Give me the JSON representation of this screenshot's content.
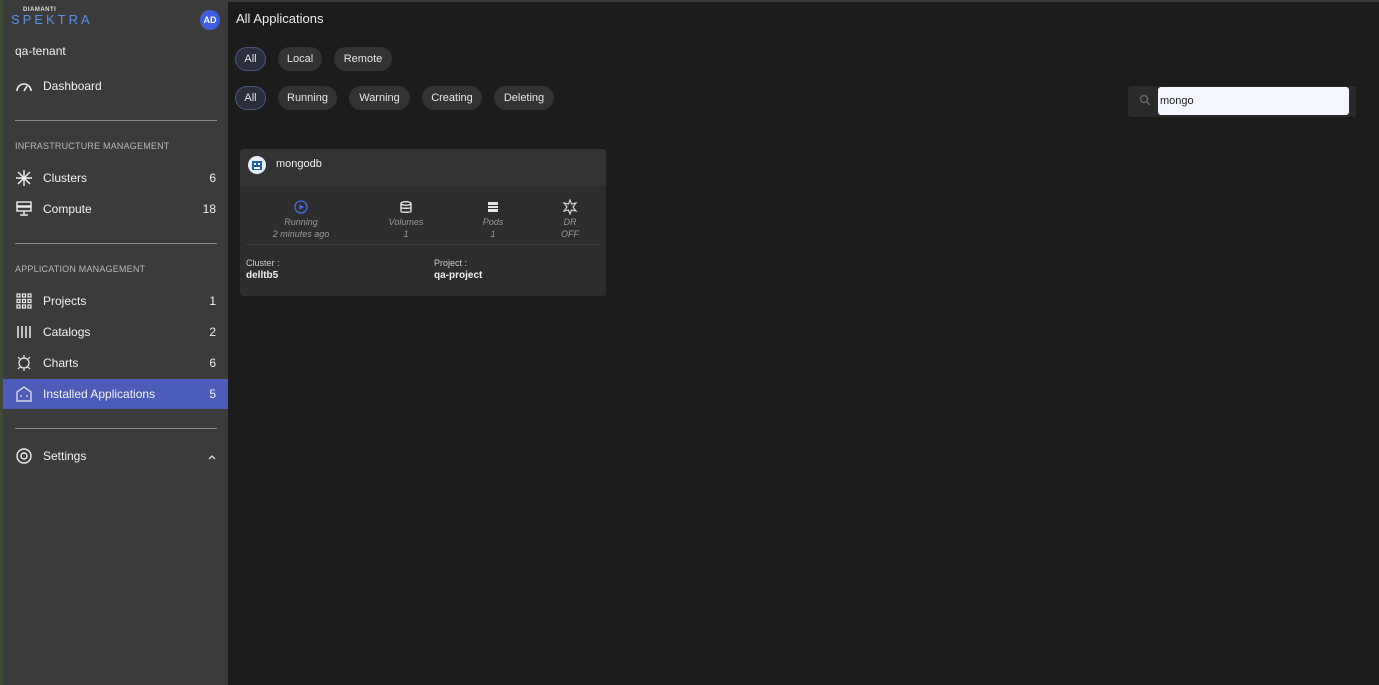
{
  "sidebar": {
    "logo_small": "DIAMANTI",
    "logo_big": "SPEKTRA",
    "avatar_initials": "AD",
    "tenant": "qa-tenant",
    "dashboard_label": "Dashboard",
    "infra_section": "INFRASTRUCTURE MANAGEMENT",
    "infra_items": [
      {
        "label": "Clusters",
        "count": "6",
        "icon": "clusters-icon"
      },
      {
        "label": "Compute",
        "count": "18",
        "icon": "compute-icon"
      }
    ],
    "app_section": "APPLICATION MANAGEMENT",
    "app_items": [
      {
        "label": "Projects",
        "count": "1",
        "icon": "projects-icon"
      },
      {
        "label": "Catalogs",
        "count": "2",
        "icon": "catalogs-icon"
      },
      {
        "label": "Charts",
        "count": "6",
        "icon": "helm-charts-icon"
      },
      {
        "label": "Installed Applications",
        "count": "5",
        "icon": "installed-apps-icon",
        "active": true
      }
    ],
    "settings_label": "Settings"
  },
  "main": {
    "title": "All Applications",
    "location_filters": [
      "All",
      "Local",
      "Remote"
    ],
    "status_filters": [
      "All",
      "Running",
      "Warning",
      "Creating",
      "Deleting"
    ],
    "search": {
      "value": "mongo"
    },
    "app_card": {
      "name": "mongodb",
      "status": "Running",
      "status_time": "2 minutes ago",
      "volumes_label": "Volumes",
      "volumes_value": "1",
      "pods_label": "Pods",
      "pods_value": "1",
      "dr_label": "DR",
      "dr_value": "OFF",
      "cluster_label": "Cluster :",
      "cluster_value": "delltb5",
      "project_label": "Project :",
      "project_value": "qa-project"
    }
  },
  "colors": {
    "sidebar_bg": "#3b3b3b",
    "main_bg": "#1c1c1c",
    "active_nav": "#4c5cb8",
    "brand_blue": "#5b8fe6",
    "avatar_blue": "#3d5ee0"
  }
}
